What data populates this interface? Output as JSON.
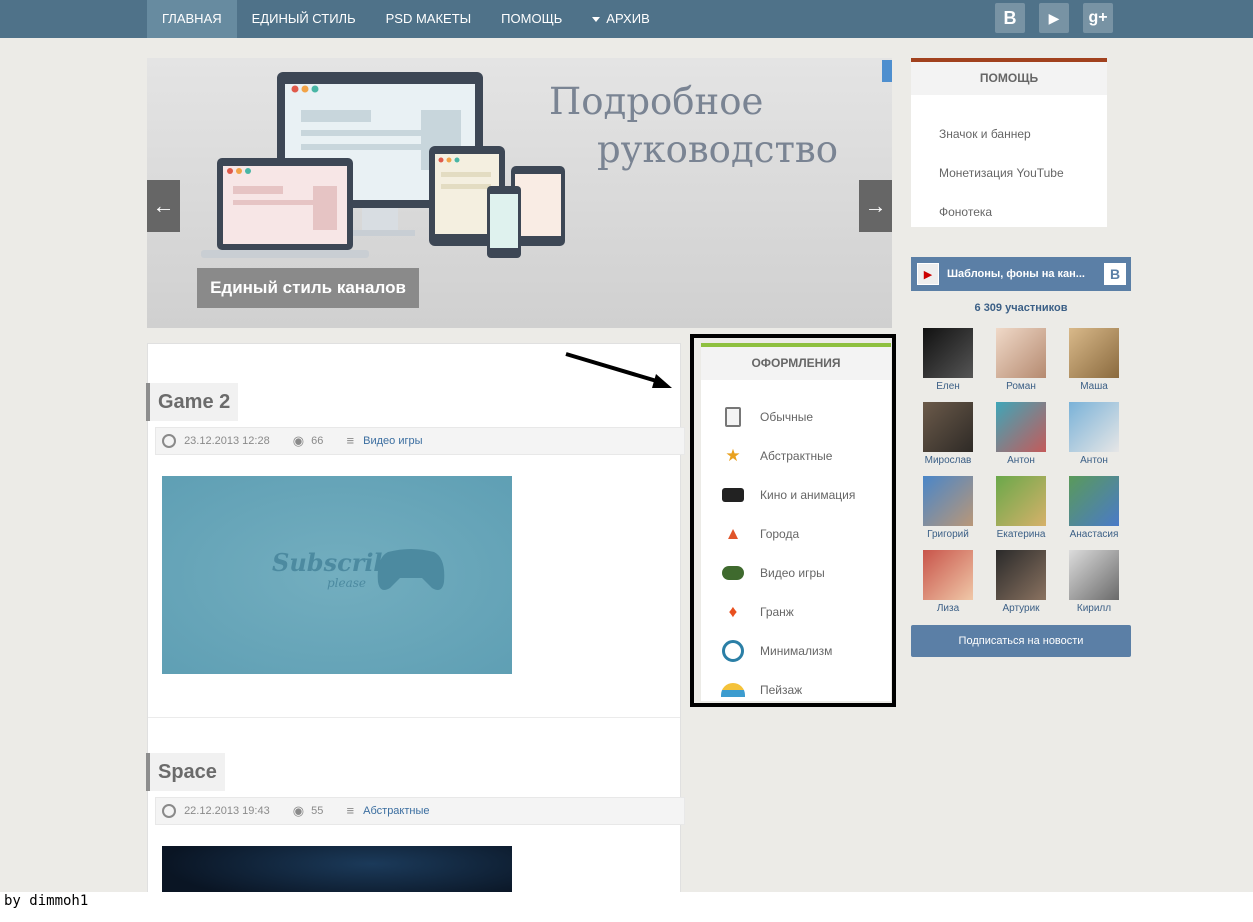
{
  "nav": {
    "items": [
      "Главная",
      "Единый стиль",
      "PSD макеты",
      "Помощь",
      "Архив"
    ],
    "social_vk": "В",
    "social_youtube": "▶",
    "social_gplus": "g+"
  },
  "slider": {
    "title_line1": "Подробное",
    "title_line2": "руководство",
    "caption": "Единый стиль каналов"
  },
  "posts": [
    {
      "title": "Game 2",
      "date": "23.12.2013 12:28",
      "views": "66",
      "category": "Видео игры",
      "thumb_text": "Subscribe",
      "thumb_sub": "please"
    },
    {
      "title": "Space",
      "date": "22.12.2013 19:43",
      "views": "55",
      "category": "Абстрактные"
    }
  ],
  "categories": {
    "heading": "Оформления",
    "items": [
      {
        "label": "Обычные",
        "icon": "notebook-icon"
      },
      {
        "label": "Абстрактные",
        "icon": "comet-icon"
      },
      {
        "label": "Кино и анимация",
        "icon": "movie-camera-icon"
      },
      {
        "label": "Города",
        "icon": "tower-icon"
      },
      {
        "label": "Видео игры",
        "icon": "gamepad-icon"
      },
      {
        "label": "Гранж",
        "icon": "flame-icon"
      },
      {
        "label": "Минимализм",
        "icon": "ring-icon"
      },
      {
        "label": "Пейзаж",
        "icon": "sunset-icon"
      }
    ]
  },
  "help": {
    "heading": "Помощь",
    "links": [
      "Значок и баннер",
      "Монетизация YouTube",
      "Фонотека"
    ]
  },
  "vk": {
    "group_name": "Шаблоны, фоны на кан...",
    "logo": "В",
    "members_count": "6 309 участников",
    "members": [
      "Елен",
      "Роман",
      "Маша",
      "Мирослав",
      "Антон",
      "Антон",
      "Григорий",
      "Екатерина",
      "Анастасия",
      "Лиза",
      "Артурик",
      "Кирилл"
    ],
    "subscribe_label": "Подписаться на новости"
  },
  "footer": {
    "byline": "by dimmoh1"
  },
  "colors": {
    "nav_bg": "#4f7289",
    "accent_green": "#8ec03f",
    "accent_rust": "#a1411e",
    "vk_blue": "#5b7fa6"
  }
}
